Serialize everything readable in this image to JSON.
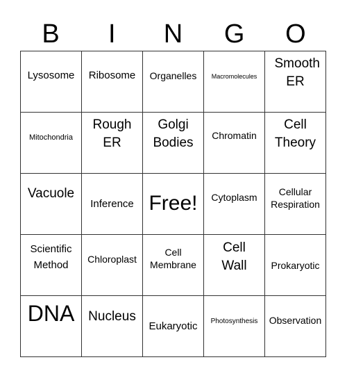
{
  "header": {
    "letters": [
      "B",
      "I",
      "N",
      "G",
      "O"
    ]
  },
  "board": {
    "rows": [
      [
        "Lysosome",
        "Ribosome",
        "Organelles",
        "Macromolecules",
        "Smooth ER"
      ],
      [
        "Mitochondria",
        "Rough ER",
        "Golgi Bodies",
        "Chromatin",
        "Cell Theory"
      ],
      [
        "Vacuole",
        "Inference",
        "Free!",
        "Cytoplasm",
        "Cellular Respiration"
      ],
      [
        "Scientific Method",
        "Chloroplast",
        "Cell Membrane",
        "Cell Wall",
        "Prokaryotic"
      ],
      [
        "DNA",
        "Nucleus",
        "Eukaryotic",
        "Photosynthesis",
        "Observation"
      ]
    ]
  }
}
